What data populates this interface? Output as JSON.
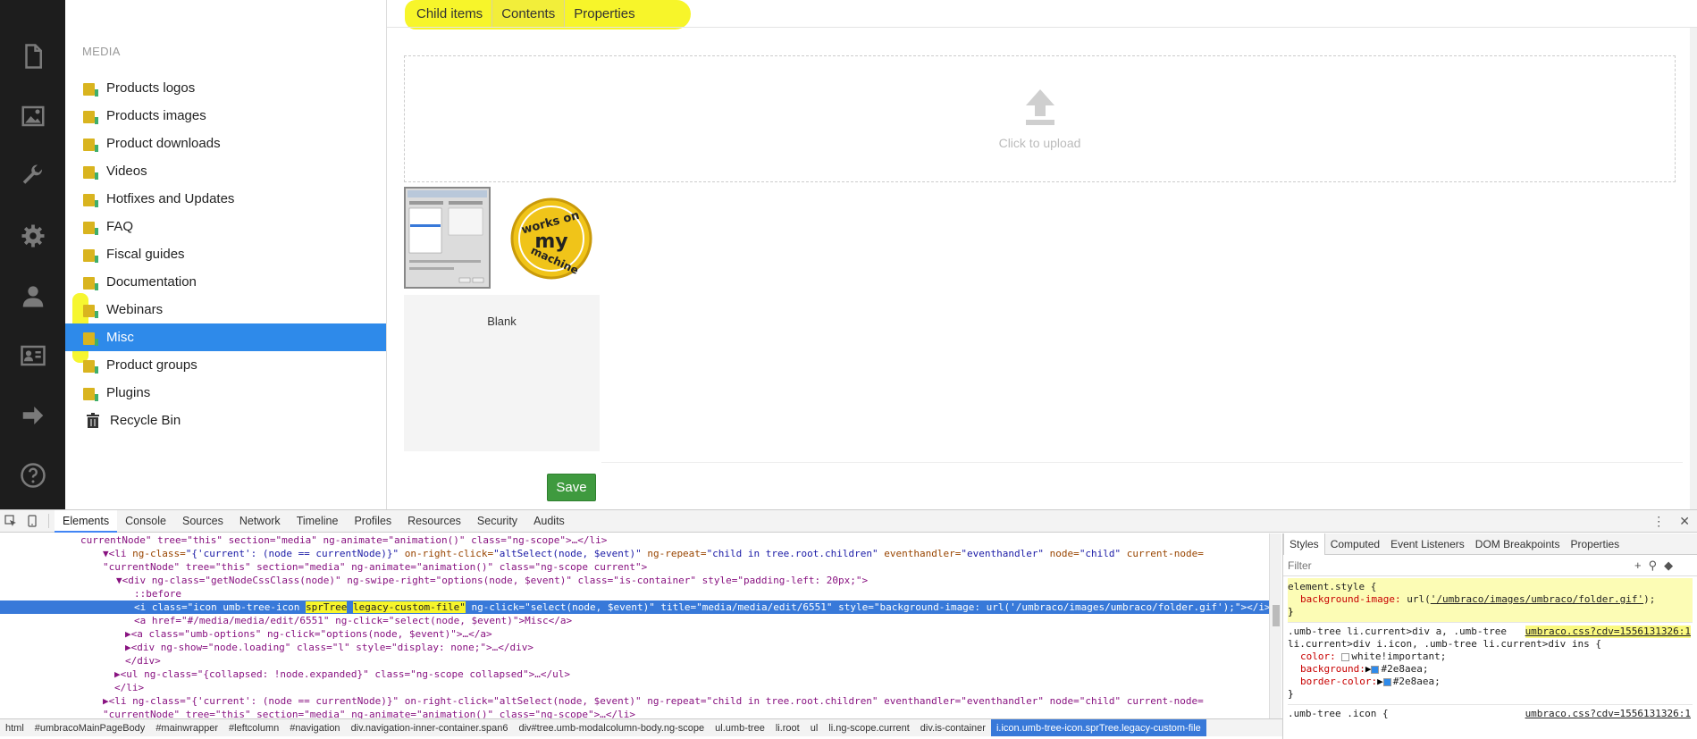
{
  "iconbar": {
    "items": [
      {
        "icon": "content-icon",
        "label": "Content"
      },
      {
        "icon": "media-icon",
        "label": "Media"
      },
      {
        "icon": "settings-wrench-icon",
        "label": "Settings"
      },
      {
        "icon": "developer-gear-icon",
        "label": "Developer"
      },
      {
        "icon": "users-icon",
        "label": "Users"
      },
      {
        "icon": "members-icon",
        "label": "Members"
      },
      {
        "icon": "forms-arrow-icon",
        "label": "Forms"
      },
      {
        "icon": "help-icon",
        "label": "Help"
      }
    ]
  },
  "tree": {
    "section_title": "MEDIA",
    "items": [
      {
        "label": "Products logos"
      },
      {
        "label": "Products images"
      },
      {
        "label": "Product downloads"
      },
      {
        "label": "Videos"
      },
      {
        "label": "Hotfixes and Updates"
      },
      {
        "label": "FAQ"
      },
      {
        "label": "Fiscal guides"
      },
      {
        "label": "Documentation"
      },
      {
        "label": "Webinars"
      },
      {
        "label": "Misc"
      },
      {
        "label": "Product groups"
      },
      {
        "label": "Plugins"
      }
    ],
    "recycle_bin": "Recycle Bin",
    "selected": "Misc"
  },
  "main": {
    "tabs": [
      {
        "label": "Child items"
      },
      {
        "label": "Contents"
      },
      {
        "label": "Properties"
      }
    ],
    "active_tab": "Contents",
    "upload_label": "Click to upload",
    "badge_lines": [
      "works on",
      "my",
      "machine"
    ],
    "blank_label": "Blank",
    "save_label": "Save"
  },
  "devtools": {
    "tabs": [
      "Elements",
      "Console",
      "Sources",
      "Network",
      "Timeline",
      "Profiles",
      "Resources",
      "Security",
      "Audits"
    ],
    "active_tab": "Elements",
    "styles_tabs": [
      "Styles",
      "Computed",
      "Event Listeners",
      "DOM Breakpoints",
      "Properties"
    ],
    "filter_placeholder": "Filter",
    "filter_icons": "+",
    "elements_lines": {
      "l0": "currentNode\" tree=\"this\" section=\"media\" ng-animate=\"animation()\" class=\"ng-scope\">…</li>",
      "l1a": "▼<li ",
      "l1b": "ng-class=",
      "l1c": "\"{'current': (node == currentNode)}\"",
      "l1d": " on-right-click=",
      "l1e": "\"altSelect(node, $event)\"",
      "l1f": " ng-repeat=",
      "l1g": "\"child in tree.root.children\"",
      "l1h": " eventhandler=",
      "l1i": "\"eventhandler\"",
      "l1j": " node=",
      "l1k": "\"child\"",
      "l1l": " current-node=",
      "l2": "\"currentNode\" tree=\"this\" section=\"media\" ng-animate=\"animation()\" class=\"ng-scope current\">",
      "l3": "▼<div ng-class=\"getNodeCssClass(node)\" ng-swipe-right=\"options(node, $event)\" class=\"is-container\" style=\"padding-left: 20px;\">",
      "l4": "::before",
      "l5a": "<i class=\"icon umb-tree-icon ",
      "l5b": "sprTree",
      "l5c": " ",
      "l5d": "legacy-custom-file\"",
      "l5e": " ng-click=\"select(node, $event)\" title=\"media/media/edit/6551\" style=\"background-image: url('/umbraco/images/umbraco/folder.gif');\"></i>",
      "l6": "<a href=\"#/media/media/edit/6551\" ng-click=\"select(node, $event)\">Misc</a>",
      "l7": "▶<a class=\"umb-options\" ng-click=\"options(node, $event)\">…</a>",
      "l8": "▶<div ng-show=\"node.loading\" class=\"l\" style=\"display: none;\">…</div>",
      "l9": "</div>",
      "l10": "▶<ul ng-class=\"{collapsed: !node.expanded}\" class=\"ng-scope collapsed\">…</ul>",
      "l11": "</li>",
      "l12": "▶<li ng-class=\"{'current': (node == currentNode)}\" on-right-click=\"altSelect(node, $event)\" ng-repeat=\"child in tree.root.children\" eventhandler=\"eventhandler\" node=\"child\" current-node=",
      "l13": "\"currentNode\" tree=\"this\" section=\"media\" ng-animate=\"animation()\" class=\"ng-scope\">…</li>"
    },
    "breadcrumbs": [
      "html",
      "#umbracoMainPageBody",
      "#mainwrapper",
      "#leftcolumn",
      "#navigation",
      "div.navigation-inner-container.span6",
      "div#tree.umb-modalcolumn-body.ng-scope",
      "ul.umb-tree",
      "li.root",
      "ul",
      "li.ng-scope.current",
      "div.is-container",
      "i.icon.umb-tree-icon.sprTree.legacy-custom-file"
    ],
    "styles": {
      "rule1_selector": "element.style {",
      "rule1_prop": "background-image:",
      "rule1_value_pre": " url(",
      "rule1_value_url": "'/umbraco/images/umbraco/folder.gif'",
      "rule1_value_post": ");",
      "rule1_close": "}",
      "rule2_selector_a": ".umb-tree li.current>div a, .umb-tree",
      "rule2_selector_b": "li.current>div i.icon, .umb-tree li.current>div ins {",
      "rule2_source": "umbraco.css?cdv=1556131326:1",
      "rule2_p1": "color:",
      "rule2_v1": "white!important;",
      "rule2_p2": "background:",
      "rule2_v2": "#2e8aea;",
      "rule2_p3": "border-color:",
      "rule2_v3": "#2e8aea;",
      "rule2_close": "}",
      "rule3_selector": ".umb-tree .icon {",
      "rule3_source": "umbraco.css?cdv=1556131326:1",
      "swatch_color": "#2e8aea"
    }
  },
  "colors": {
    "accent": "#2e8aea",
    "highlighter": "#f7f52a",
    "save": "#3f9a3f",
    "iconbar": "#1d1d1d"
  }
}
